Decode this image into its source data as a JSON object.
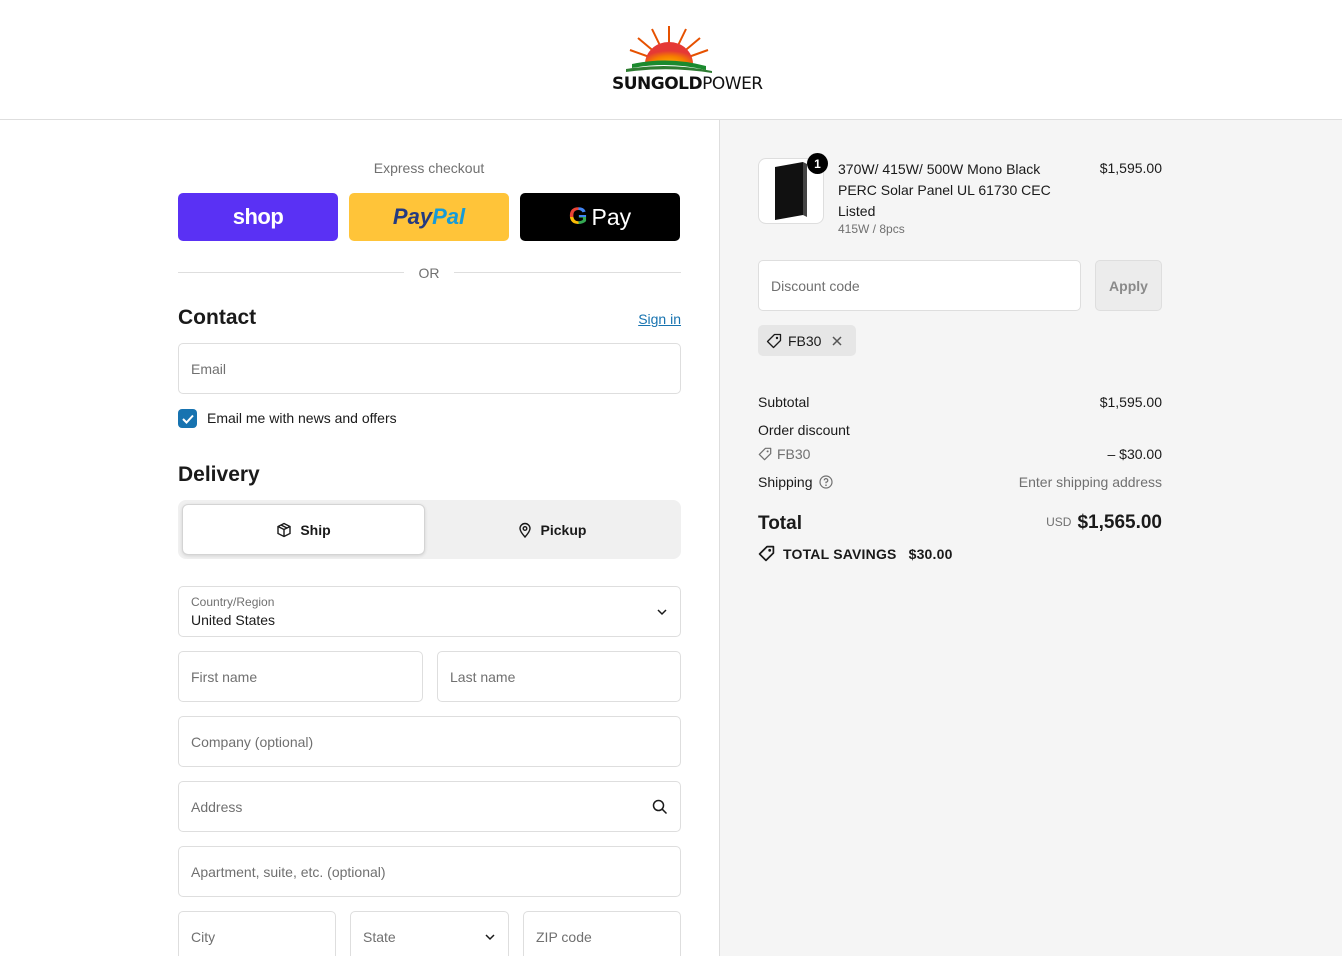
{
  "brand": {
    "logo_bold": "SUNGOLD",
    "logo_light": "POWER"
  },
  "express": {
    "title": "Express checkout",
    "shop_label": "shop",
    "paypal_label_1": "Pay",
    "paypal_label_2": "Pal",
    "gpay_g": "G",
    "gpay_label": "Pay",
    "or_label": "OR"
  },
  "contact": {
    "title": "Contact",
    "signin_label": "Sign in",
    "email_placeholder": "Email",
    "newsletter_label": "Email me with news and offers",
    "newsletter_checked": true
  },
  "delivery": {
    "title": "Delivery",
    "options": [
      {
        "label": "Ship",
        "icon": "box-icon",
        "selected": true
      },
      {
        "label": "Pickup",
        "icon": "location-pin-icon",
        "selected": false
      }
    ],
    "country_label": "Country/Region",
    "country_value": "United States",
    "first_name": "First name",
    "last_name": "Last name",
    "company": "Company (optional)",
    "address": "Address",
    "apartment": "Apartment, suite, etc. (optional)",
    "city": "City",
    "state": "State",
    "zip": "ZIP code"
  },
  "summary": {
    "product": {
      "quantity": "1",
      "title": "370W/ 415W/ 500W Mono Black PERC Solar Panel UL 61730 CEC Listed",
      "variant": "415W / 8pcs",
      "price": "$1,595.00"
    },
    "discount_placeholder": "Discount code",
    "apply_label": "Apply",
    "applied_code": "FB30",
    "subtotal_label": "Subtotal",
    "subtotal_value": "$1,595.00",
    "order_discount_label": "Order discount",
    "order_discount_code": "FB30",
    "order_discount_value": "– $30.00",
    "shipping_label": "Shipping",
    "shipping_value": "Enter shipping address",
    "total_label": "Total",
    "total_currency": "USD",
    "total_value": "$1,565.00",
    "savings_label": "TOTAL SAVINGS",
    "savings_value": "$30.00"
  },
  "colors": {
    "accent": "#1773b0",
    "shop": "#5a31f4",
    "paypal": "#ffc439",
    "gpay": "#000000"
  }
}
